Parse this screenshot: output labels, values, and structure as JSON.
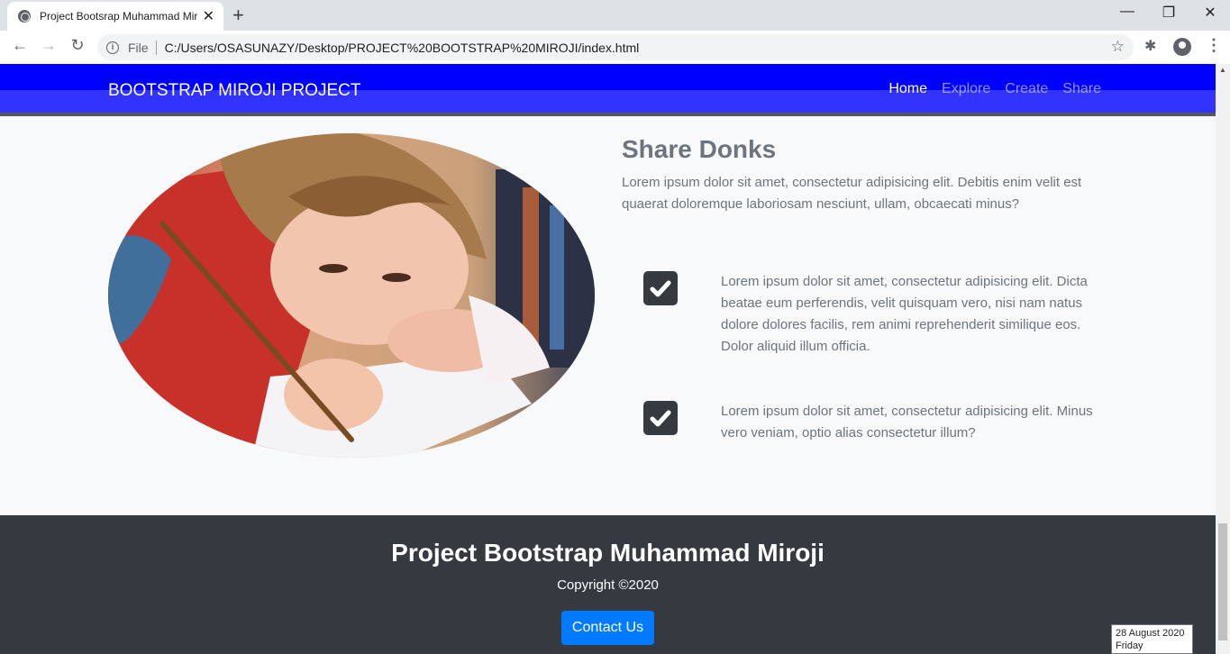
{
  "browser": {
    "tab_title": "Project Bootsrap Muhammad Miroji",
    "tab_close": "✕",
    "new_tab": "+",
    "window_controls": {
      "minimize": "—",
      "restore": "❐",
      "close": "✕"
    },
    "nav": {
      "back": "←",
      "forward": "→",
      "reload": "↻"
    },
    "info_glyph": "i",
    "file_label": "File",
    "url": "C:/Users/OSASUNAZY/Desktop/PROJECT%20BOOTSTRAP%20MIROJI/index.html",
    "star": "☆",
    "extensions": "✱",
    "menu": "⋮"
  },
  "navbar": {
    "brand": "BOOTSTRAP MIROJI PROJECT",
    "links": [
      "Home",
      "Explore",
      "Create",
      "Share"
    ],
    "active_link": "Home",
    "color": "#0000ff"
  },
  "section": {
    "title": "Share Donks",
    "text": "Lorem ipsum dolor sit amet, consectetur adipisicing elit. Debitis enim velit est quaerat doloremque laboriosam nesciunt, ullam, obcaecati minus?",
    "features": [
      {
        "icon": "check-square-icon",
        "text": "Lorem ipsum dolor sit amet, consectetur adipisicing elit. Dicta beatae eum perferendis, velit quisquam vero, nisi nam natus dolore dolores facilis, rem animi reprehenderit similique eos. Dolor aliquid illum officia."
      },
      {
        "icon": "check-square-icon",
        "text": "Lorem ipsum dolor sit amet, consectetur adipisicing elit. Minus vero veniam, optio alias consectetur illum?"
      }
    ]
  },
  "footer": {
    "title": "Project Bootstrap Muhammad Miroji",
    "copyright": "Copyright ©2020",
    "contact_button": "Contact Us",
    "background": "#343a40",
    "button_color": "#007bff"
  },
  "taskbar_tooltip": {
    "date": "28 August 2020",
    "day": "Friday"
  }
}
